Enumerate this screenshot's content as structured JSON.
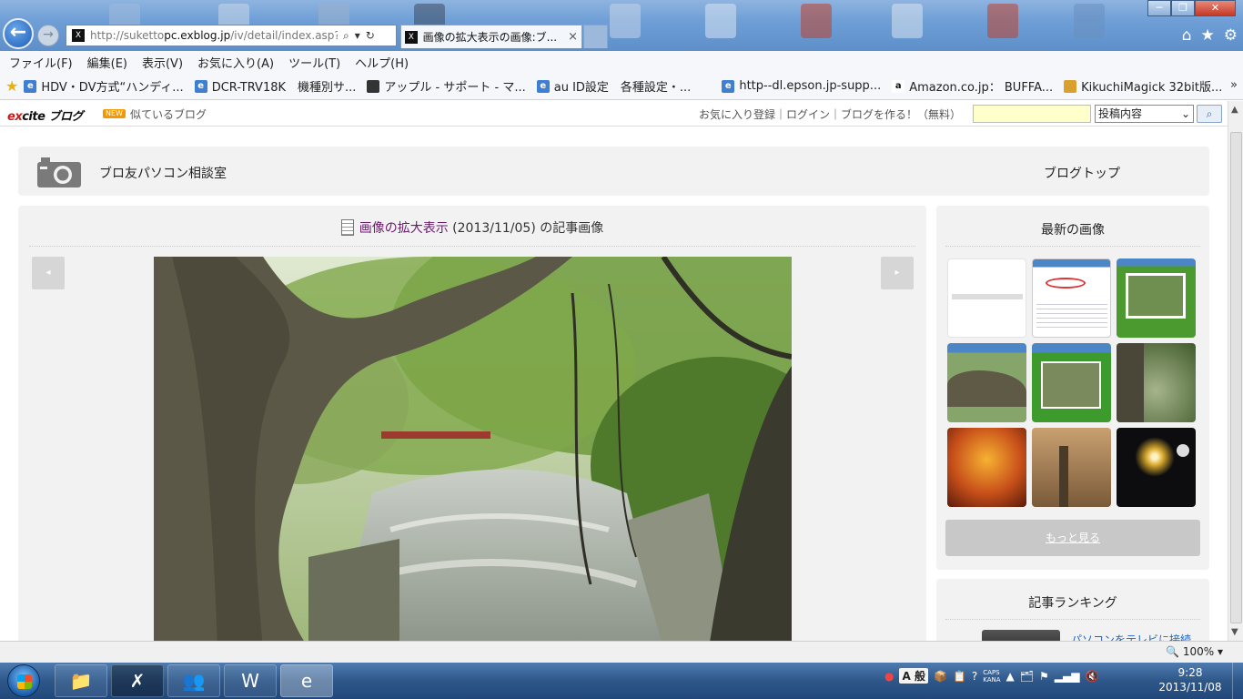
{
  "browser": {
    "address_url_prefix": "http://suketto",
    "address_url_domain": "pc.exblog.jp",
    "address_url_path": "/iv/detail/index.asp?",
    "tab_title": "画像の拡大表示の画像:ブ...",
    "tab_close": "×",
    "back_glyph": "←",
    "forward_glyph": "→",
    "search_glyph": "⌕",
    "dropdown_glyph": "▾",
    "refresh_glyph": "↻",
    "minimize_glyph": "─",
    "maximize_glyph": "❐",
    "close_glyph": "✕",
    "home_glyph": "⌂",
    "favorites_glyph": "★",
    "tools_glyph": "⚙",
    "menu": [
      "ファイル(F)",
      "編集(E)",
      "表示(V)",
      "お気に入り(A)",
      "ツール(T)",
      "ヘルプ(H)"
    ],
    "favorites": [
      {
        "label": "HDV・DV方式“ハンディ...",
        "icon": "ie-page-icon"
      },
      {
        "label": "DCR-TRV18K　機種別サ...",
        "icon": "ie-page-icon"
      },
      {
        "label": "アップル - サポート - マ...",
        "icon": "apple-icon"
      },
      {
        "label": "au ID設定　各種設定・...",
        "icon": "ie-page-icon"
      },
      {
        "label": "http--dl.epson.jp-supp...",
        "icon": "ie-page-icon"
      },
      {
        "label": "Amazon.co.jp：  BUFFA...",
        "icon": "amazon-icon"
      },
      {
        "label": "KikuchiMagick 32bit版...",
        "icon": "cat-icon"
      }
    ],
    "favorites_chevron": "»",
    "zoom": "100%"
  },
  "excite": {
    "logo_ex": "e",
    "logo_x": "x",
    "logo_rest": "cite ブログ",
    "new_badge": "NEW",
    "similar": "似ているブログ",
    "userlinks": "お気に入り登録｜ログイン｜ブログを作る！（無料）",
    "search_select": "投稿内容",
    "search_button": "🔍"
  },
  "blog": {
    "title": "ブロ友パソコン相談室",
    "top_link": "ブログトップ"
  },
  "main": {
    "heading_link": "画像の拡大表示",
    "heading_rest": " (2013/11/05) の記事画像",
    "prev": "◂",
    "next": "▸"
  },
  "sidebar": {
    "latest_title": "最新の画像",
    "more": "もっと見る",
    "ranking_title": "記事ランキング",
    "ranking_first": "パソコンをテレビに接続..."
  },
  "taskbar": {
    "ime_a": "A",
    "ime_mode": "般",
    "caps": "CAPS",
    "kana": "KANA",
    "clock_time": "9:28",
    "clock_date": "2013/11/08"
  }
}
